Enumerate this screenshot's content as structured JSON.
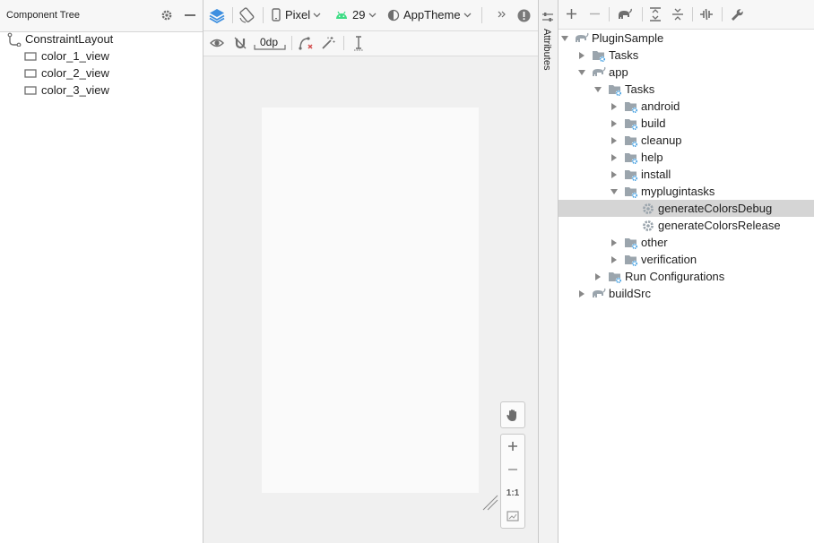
{
  "component_tree": {
    "title": "Component Tree",
    "root": "ConstraintLayout",
    "children": [
      "color_1_view",
      "color_2_view",
      "color_3_view"
    ]
  },
  "design_toolbar": {
    "device": "Pixel",
    "api_level": "29",
    "theme": "AppTheme",
    "default_margin": "0dp"
  },
  "zoom_controls": {
    "reset_label": "1:1"
  },
  "attributes_tab": {
    "label": "Attributes"
  },
  "gradle_tree": {
    "root": "PluginSample",
    "root_tasks": "Tasks",
    "module_app": "app",
    "app_tasks": "Tasks",
    "task_groups": [
      "android",
      "build",
      "cleanup",
      "help",
      "install",
      "myplugintasks"
    ],
    "plugin_tasks": [
      "generateColorsDebug",
      "generateColorsRelease"
    ],
    "more_groups": [
      "other",
      "verification"
    ],
    "run_configurations": "Run Configurations",
    "module_buildsrc": "buildSrc",
    "selected": "generateColorsDebug"
  },
  "colors": {
    "accent_blue": "#3d8fe0",
    "icon_gray": "#6e6e6e",
    "android_green": "#3ddc84",
    "selection_gray": "#d5d5d5"
  }
}
